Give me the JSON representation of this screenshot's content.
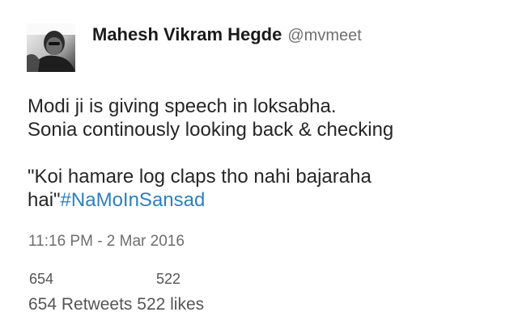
{
  "tweet": {
    "author_name": "Mahesh Vikram Hegde",
    "author_handle": "@mvmeet",
    "avatar_icon": "user-avatar-photo",
    "text_line1": "Modi ji is giving speech in loksabha.",
    "text_line2": "Sonia continously looking back & checking",
    "text_line3": "\"Koi hamare log claps tho nahi bajaraha",
    "text_line4_prefix": "hai\"",
    "hashtag": "#NaMoInSansad",
    "timestamp": "11:16 PM - 2 Mar 2016",
    "retweet_count": "654",
    "like_count": "522",
    "retweets_label": "654 Retweets",
    "likes_label": "522 likes"
  },
  "colors": {
    "hashtag": "#2f7fb8",
    "handle": "#6f6f6f",
    "text": "#262626"
  }
}
